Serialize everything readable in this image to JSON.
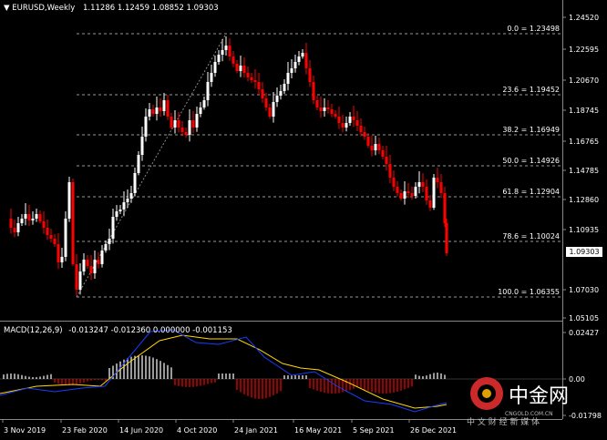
{
  "header": {
    "symbol": "EURUSD,Weekly",
    "ohlc": "1.11286 1.12459 1.08852 1.09303"
  },
  "macd": {
    "title": "MACD(12,26,9)",
    "values": "-0.013247 -0.012360 0.000000 -0.001153"
  },
  "price_axis": {
    "labels": [
      "1.24520",
      "1.22595",
      "1.20670",
      "1.18745",
      "1.16765",
      "1.14785",
      "1.12860",
      "1.10935",
      "1.09303",
      "1.07030",
      "1.05105"
    ],
    "current": "1.09303"
  },
  "macd_axis": {
    "labels": [
      "0.02427",
      "0.00",
      "-0.01798"
    ]
  },
  "time_axis": {
    "labels": [
      "3 Nov 2019",
      "23 Feb 2020",
      "14 Jun 2020",
      "4 Oct 2020",
      "24 Jan 2021",
      "16 May 2021",
      "5 Sep 2021",
      "26 Dec 2021"
    ]
  },
  "fibo": {
    "levels": [
      "0.0 = 1.23498",
      "23.6 = 1.19452",
      "38.2 = 1.16949",
      "50.0 = 1.14926",
      "61.8 = 1.12904",
      "78.6 = 1.10024",
      "100.0 = 1.06355"
    ]
  },
  "watermark": {
    "logo_text": "中金网",
    "site": "CNGOLD.COM.CN",
    "slogan": "中 文 财 经 新 媒 体"
  },
  "colors": {
    "up": "#ffffff",
    "down": "#ff0000",
    "grid": "#aaaaaa",
    "signal": "#ffd700",
    "macd_line": "#1a3cff"
  }
}
